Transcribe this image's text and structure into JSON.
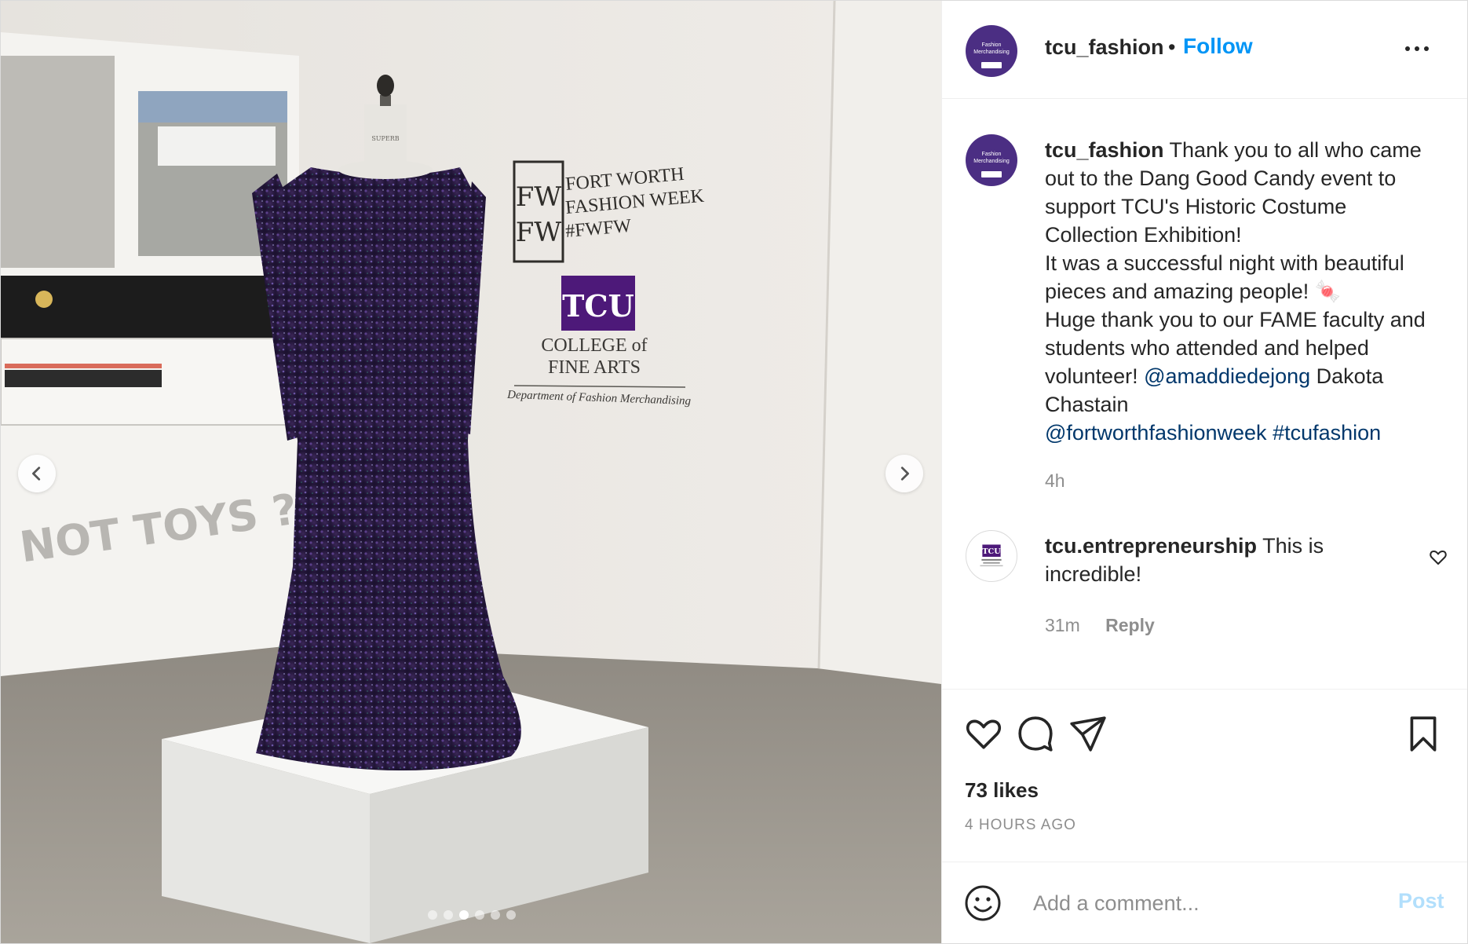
{
  "post": {
    "author": "tcu_fashion",
    "follow_label": "Follow",
    "separator": "•",
    "author_avatar_text": "Fashion Merchandising",
    "caption": {
      "lines": [
        "Thank you to all who came out to the Dang Good Candy event to support TCU's Historic Costume Collection Exhibition!",
        "It was a successful night with beautiful pieces and amazing people! 🍬",
        "Huge thank you to our FAME faculty and students who attended and helped volunteer!",
        "Dakota Chastain"
      ],
      "mention_1": "@amaddiedejong",
      "mention_2": "@fortworthfashionweek",
      "hashtag": "#tcufashion",
      "time": "4h"
    },
    "comments": [
      {
        "user": "tcu.entrepreneurship",
        "text": "This is incredible!",
        "time": "31m",
        "reply_label": "Reply",
        "avatar_text": "TCU Neeley School of Business"
      }
    ],
    "likes": "73 likes",
    "time_ago": "4 HOURS AGO",
    "comment_placeholder": "Add a comment...",
    "post_label": "Post"
  },
  "media": {
    "carousel_count": 6,
    "active_index": 2,
    "wall_sign": {
      "fwfw": [
        "FW",
        "FW"
      ],
      "lines": [
        "FORT WORTH",
        "FASHION WEEK",
        "#FWFW"
      ],
      "logo": "TCU",
      "college_1": "COLLEGE of",
      "college_2": "FINE ARTS",
      "department": "Department of Fashion Merchandising"
    },
    "banner_text": "NOT  TOYS  ?",
    "form_label": "SUPERB"
  },
  "colors": {
    "accent": "#0095f6",
    "link": "#00376b",
    "tcu_purple": "#4d1979"
  }
}
